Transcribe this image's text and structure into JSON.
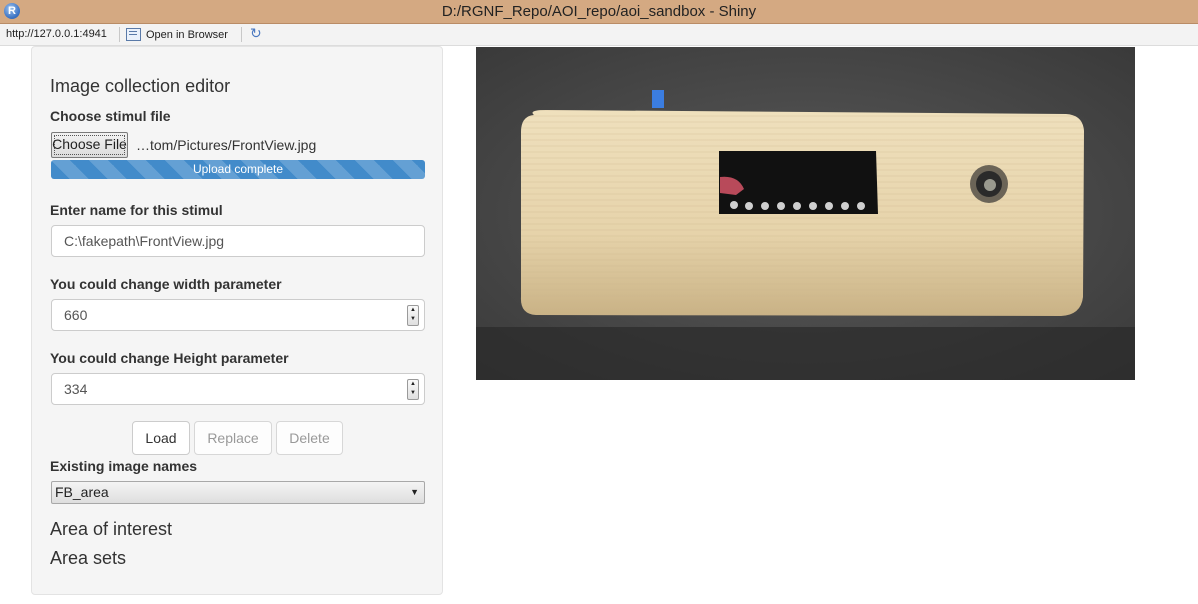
{
  "window": {
    "title": "D:/RGNF_Repo/AOI_repo/aoi_sandbox - Shiny",
    "app_icon_letter": "R"
  },
  "addressbar": {
    "url": "http://127.0.0.1:4941",
    "open_in_browser_label": "Open in Browser"
  },
  "sidebar": {
    "heading": "Image collection editor",
    "choose_label": "Choose stimul file",
    "choose_button_label": "Choose File",
    "file_name": "…tom/Pictures/FrontView.jpg",
    "upload_status": "Upload complete",
    "upload_progress": 1.0,
    "name_label": "Enter name for this stimul",
    "name_value": "C:\\fakepath\\FrontView.jpg",
    "width_label": "You could change width parameter",
    "width_value": "660",
    "height_label": "You could change Height parameter",
    "height_value": "334",
    "load_label": "Load",
    "replace_label": "Replace",
    "delete_label": "Delete",
    "existing_label": "Existing image names",
    "existing_selected": "FB_area",
    "aoi_heading": "Area of interest",
    "sets_heading": "Area sets"
  },
  "colors": {
    "titlebar": "#d4a982",
    "progress": "#428bca"
  }
}
